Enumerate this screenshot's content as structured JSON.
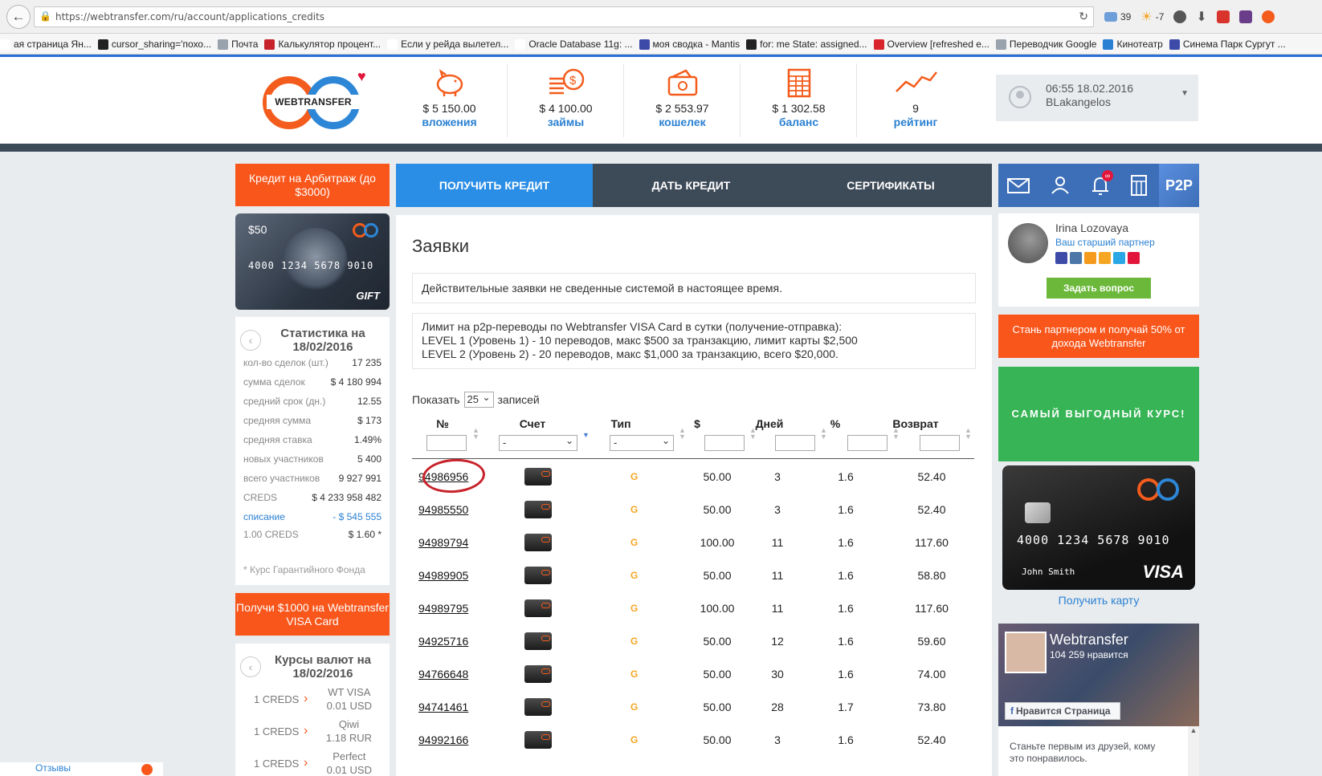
{
  "browser": {
    "url": "https://webtransfer.com/ru/account/applications_credits",
    "mail_count": "39",
    "weather": "-7",
    "bookmarks": [
      {
        "label": "ая страница Ян...",
        "color": "#ffffff"
      },
      {
        "label": "cursor_sharing='похо...",
        "color": "#222222"
      },
      {
        "label": "Почта",
        "color": "#9aa3ad"
      },
      {
        "label": "Калькулятор процент...",
        "color": "#c8232b"
      },
      {
        "label": "Если у рейда вылетел...",
        "color": "#ffffff"
      },
      {
        "label": "Oracle Database 11g: ...",
        "color": "#ffffff"
      },
      {
        "label": "моя сводка - Mantis",
        "color": "#3d4aa8"
      },
      {
        "label": "for: me State: assigned...",
        "color": "#222222"
      },
      {
        "label": "Overview [refreshed e...",
        "color": "#d8242b"
      },
      {
        "label": "Переводчик Google",
        "color": "#9aa3ad"
      },
      {
        "label": "Кинотеатр",
        "color": "#2a80d2"
      },
      {
        "label": "Синема Парк Сургут ...",
        "color": "#3d4aa8"
      }
    ]
  },
  "header": {
    "logo_text": "WEBTRANSFER",
    "stats": [
      {
        "value": "$ 5 150.00",
        "label": "вложения",
        "icon": "piggy-bank-icon"
      },
      {
        "value": "$ 4 100.00",
        "label": "займы",
        "icon": "coins-icon"
      },
      {
        "value": "$ 2 553.97",
        "label": "кошелек",
        "icon": "wallet-icon"
      },
      {
        "value": "$ 1 302.58",
        "label": "баланс",
        "icon": "calculator-icon"
      },
      {
        "value": "9",
        "label": "рейтинг",
        "icon": "rating-chart-icon"
      }
    ],
    "user": {
      "time": "06:55 18.02.2016",
      "name": "BLakangelos"
    }
  },
  "left": {
    "arbitrage_btn": "Кредит на Арбитраж (до $3000)",
    "gift_card": {
      "amount": "$50",
      "number": "4000 1234 5678 9010",
      "label": "GIFT"
    },
    "stats_title": "Статистика на 18/02/2016",
    "stats": [
      {
        "k": "кол-во сделок (шт.)",
        "v": "17 235"
      },
      {
        "k": "сумма сделок",
        "v": "$ 4 180 994"
      },
      {
        "k": "средний срок (дн.)",
        "v": "12.55"
      },
      {
        "k": "средняя сумма",
        "v": "$ 173"
      },
      {
        "k": "средняя ставка",
        "v": "1.49%"
      },
      {
        "k": "новых участников",
        "v": "5 400"
      },
      {
        "k": "всего участников",
        "v": "9 927 991"
      },
      {
        "k": "CREDS",
        "v": "$ 4 233 958 482"
      },
      {
        "k": "списание",
        "v": "- $ 545 555"
      },
      {
        "k": "1.00 CREDS",
        "v": "$ 1.60 *"
      }
    ],
    "fund_note": "* Курс Гарантийного Фонда",
    "visa_btn": "Получи $1000 на Webtransfer VISA Card",
    "rates_title": "Курсы валют на 18/02/2016",
    "rates": [
      {
        "k": "1 CREDS",
        "v1": "WT VISA",
        "v2": "0.01 USD"
      },
      {
        "k": "1 CREDS",
        "v1": "Qiwi",
        "v2": "1.18 RUR"
      },
      {
        "k": "1 CREDS",
        "v1": "Perfect",
        "v2": "0.01 USD"
      }
    ],
    "reviews": "Отзывы"
  },
  "tabs": [
    {
      "label": "ПОЛУЧИТЬ КРЕДИТ",
      "active": true
    },
    {
      "label": "ДАТЬ КРЕДИТ",
      "active": false
    },
    {
      "label": "СЕРТИФИКАТЫ",
      "active": false
    }
  ],
  "main": {
    "title": "Заявки",
    "notice1": "Действительные заявки не сведенные системой в настоящее время.",
    "notice2": [
      "Лимит на p2p-переводы по Webtransfer VISA Card в сутки (получение-отправка):",
      "LEVEL 1 (Уровень 1) - 10 переводов, макс $500 за транзакцию, лимит карты $2,500",
      "LEVEL 2 (Уровень 2) - 20 переводов, макс $1,000 за транзакцию, всего $20,000."
    ],
    "show_label": "Показать",
    "page_size": "25",
    "entries_label": "записей",
    "columns": [
      "№",
      "Счет",
      "Тип",
      "$",
      "Дней",
      "%",
      "Возврат"
    ],
    "filter_dash": "-",
    "rows": [
      {
        "id": "94986956",
        "type": "G",
        "amount": "50.00",
        "days": "3",
        "pct": "1.6",
        "ret": "52.40"
      },
      {
        "id": "94985550",
        "type": "G",
        "amount": "50.00",
        "days": "3",
        "pct": "1.6",
        "ret": "52.40"
      },
      {
        "id": "94989794",
        "type": "G",
        "amount": "100.00",
        "days": "11",
        "pct": "1.6",
        "ret": "117.60"
      },
      {
        "id": "94989905",
        "type": "G",
        "amount": "50.00",
        "days": "11",
        "pct": "1.6",
        "ret": "58.80"
      },
      {
        "id": "94989795",
        "type": "G",
        "amount": "100.00",
        "days": "11",
        "pct": "1.6",
        "ret": "117.60"
      },
      {
        "id": "94925716",
        "type": "G",
        "amount": "50.00",
        "days": "12",
        "pct": "1.6",
        "ret": "59.60"
      },
      {
        "id": "94766648",
        "type": "G",
        "amount": "50.00",
        "days": "30",
        "pct": "1.6",
        "ret": "74.00"
      },
      {
        "id": "94741461",
        "type": "G",
        "amount": "50.00",
        "days": "28",
        "pct": "1.7",
        "ret": "73.80"
      },
      {
        "id": "94992166",
        "type": "G",
        "amount": "50.00",
        "days": "3",
        "pct": "1.6",
        "ret": "52.40"
      }
    ]
  },
  "right": {
    "notif_badge": "∞",
    "p2p_label": "P2P",
    "partner_name": "Irina Lozovaya",
    "partner_role": "Ваш старший партнер",
    "ask_btn": "Задать вопрос",
    "partner_cta": "Стань партнером и получай 50% от дохода Webtransfer",
    "green_banner": "САМЫЙ ВЫГОДНЫЙ КУРС!",
    "visa_card": {
      "number": "4000 1234 5678 9010",
      "holder": "John Smith",
      "brand": "VISA"
    },
    "get_card": "Получить карту",
    "fb": {
      "name": "Webtransfer",
      "likes": "104 259 нравится",
      "like_btn": "Нравится Страница",
      "text": "Станьте первым из друзей, кому это понравилось."
    }
  },
  "colors": {
    "orange": "#f8561b",
    "blue": "#2a8de6",
    "dark": "#3d4a58",
    "green": "#37b556"
  }
}
